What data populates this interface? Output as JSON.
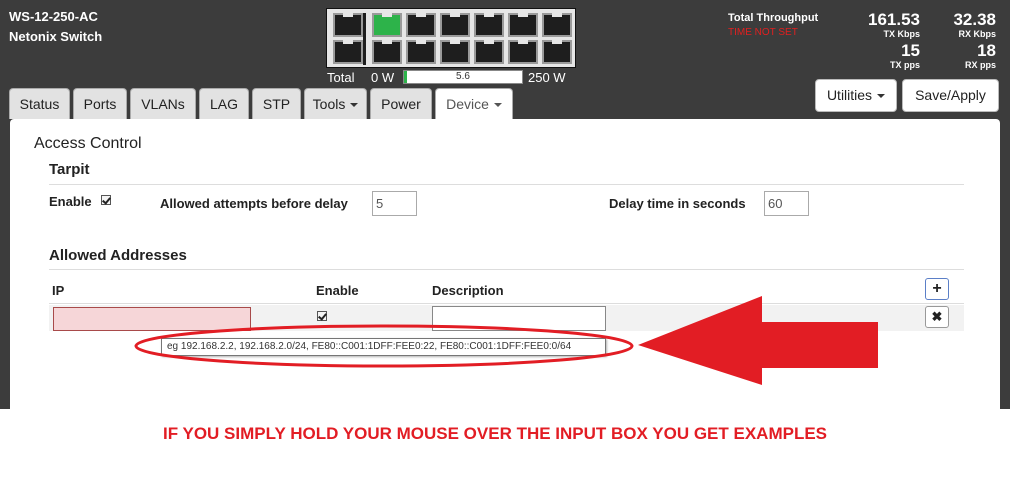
{
  "device": {
    "model": "WS-12-250-AC",
    "name": "Netonix Switch"
  },
  "power": {
    "total_label": "Total",
    "min": "0 W",
    "current": "5.6",
    "max": "250 W",
    "fraction": 0.022
  },
  "throughput": {
    "label": "Total Throughput",
    "status": "TIME NOT SET",
    "tx_kbps": "161.53",
    "tx_kbps_label": "TX Kbps",
    "rx_kbps": "32.38",
    "rx_kbps_label": "RX Kbps",
    "tx_pps": "15",
    "tx_pps_label": "TX pps",
    "rx_pps": "18",
    "rx_pps_label": "RX pps"
  },
  "tabs": [
    {
      "label": "Status"
    },
    {
      "label": "Ports"
    },
    {
      "label": "VLANs"
    },
    {
      "label": "LAG"
    },
    {
      "label": "STP"
    },
    {
      "label": "Tools"
    },
    {
      "label": "Power"
    },
    {
      "label": "Device"
    }
  ],
  "toolbar": {
    "utilities_label": "Utilities",
    "save_label": "Save/Apply"
  },
  "access_control": {
    "title": "Access Control",
    "tarpit": {
      "title": "Tarpit",
      "enable_label": "Enable",
      "attempts_label": "Allowed attempts before delay",
      "attempts_value": "5",
      "delay_label": "Delay time in seconds",
      "delay_value": "60"
    },
    "allowed": {
      "title": "Allowed Addresses",
      "col_ip": "IP",
      "col_enable": "Enable",
      "col_description": "Description",
      "add_label": "+",
      "remove_label": "✖",
      "ip_value": "",
      "description_value": ""
    }
  },
  "tooltip": "eg 192.168.2.2, 192.168.2.0/24, FE80::C001:1DFF:FEE0:22, FE80::C001:1DFF:FEE0:0/64",
  "annotation": {
    "caption": "IF YOU SIMPLY HOLD YOUR MOUSE OVER THE INPUT BOX YOU GET EXAMPLES",
    "color": "#e21d24"
  },
  "colors": {
    "header_bg": "#3c3c3c",
    "port_up": "#2db34a",
    "alert": "#e02020"
  }
}
